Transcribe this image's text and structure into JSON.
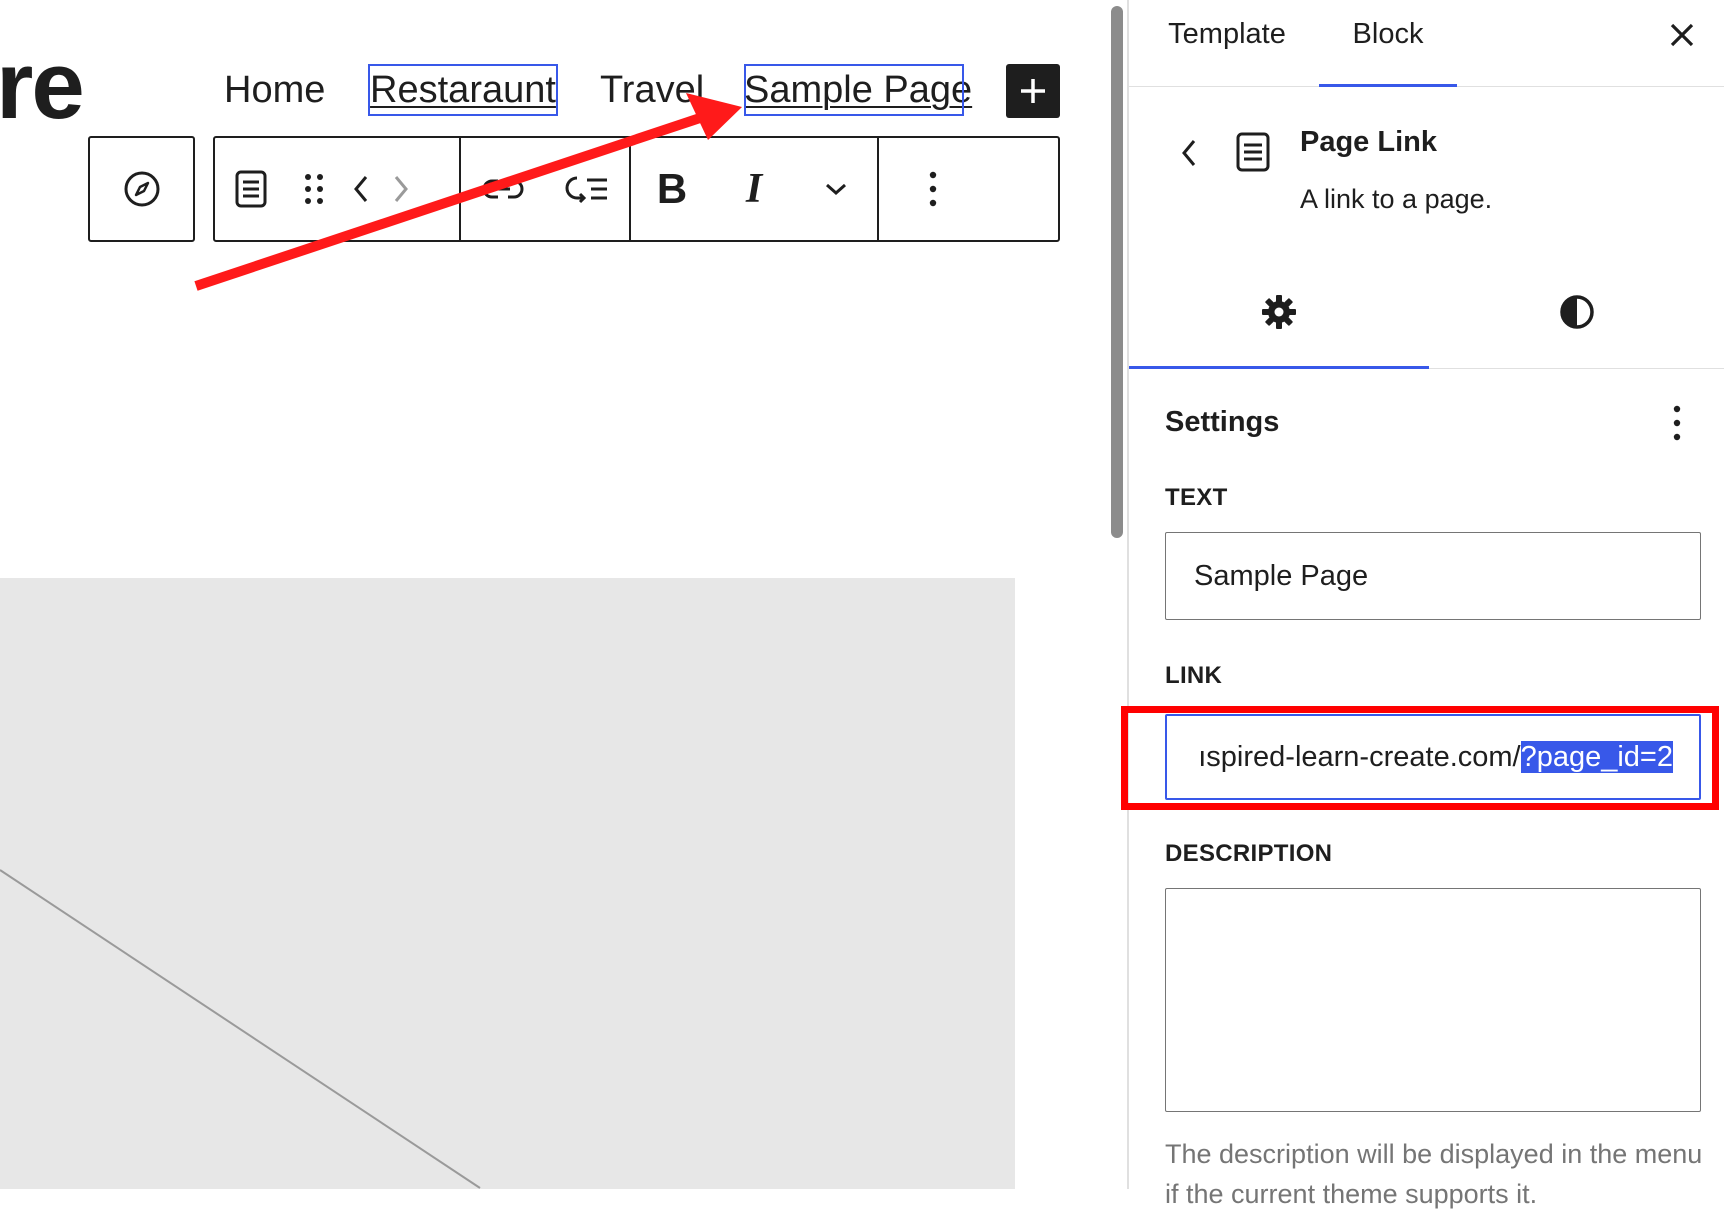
{
  "site": {
    "title_fragment": "re"
  },
  "navigation": {
    "items": [
      {
        "label": "Home"
      },
      {
        "label": "Restaraunt"
      },
      {
        "label": "Travel"
      },
      {
        "label": "Sample Page"
      }
    ]
  },
  "block_toolbar": {
    "icons": [
      "compass-icon",
      "page-icon",
      "drag-handle-icon",
      "move-left-icon",
      "move-right-icon",
      "link-unlink-icon",
      "add-submenu-icon",
      "bold-icon",
      "italic-icon",
      "more-formats-chevron-icon",
      "options-icon"
    ],
    "bold_label": "B",
    "italic_label": "I"
  },
  "sidebar": {
    "tabs": [
      {
        "label": "Template"
      },
      {
        "label": "Block",
        "active": true
      }
    ],
    "block_card": {
      "title": "Page Link",
      "description": "A link to a page."
    },
    "subtabs": [
      "settings-gear-icon",
      "styles-contrast-icon"
    ],
    "panel": {
      "title": "Settings",
      "text_label": "TEXT",
      "text_value": "Sample Page",
      "link_label": "LINK",
      "link_value_visible": "ıspired-learn-create.com/",
      "link_value_selected": "?page_id=2",
      "description_label": "DESCRIPTION",
      "description_value": "",
      "help_text": "The description will be displayed in the menu if the current theme supports it."
    }
  },
  "colors": {
    "accent": "#3858e9",
    "annotation_red": "#ff0000",
    "placeholder_bg": "#e7e7e7"
  }
}
